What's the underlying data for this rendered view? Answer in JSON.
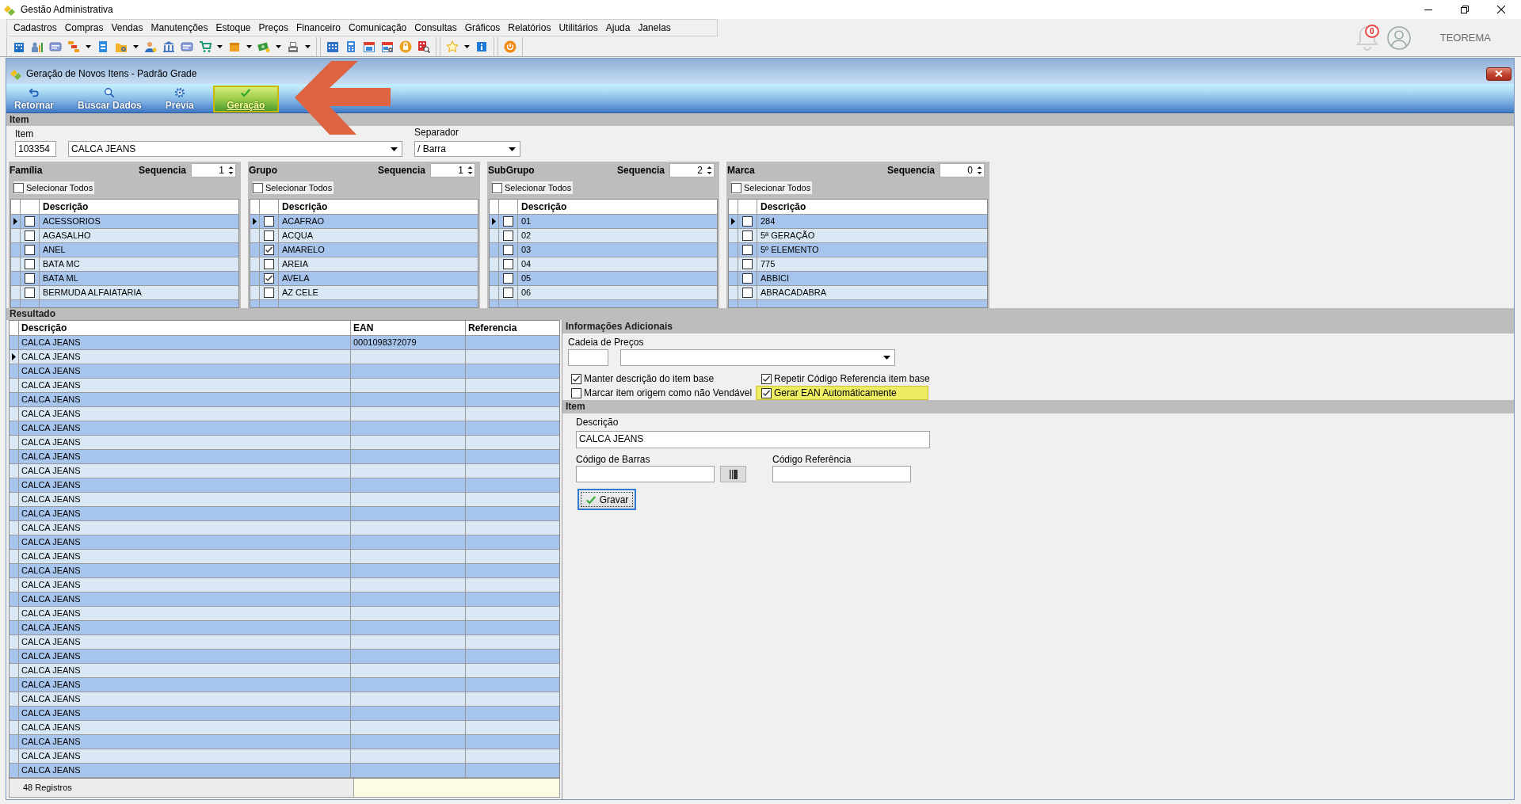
{
  "app_window": {
    "title": "Gestão Administrativa"
  },
  "menu_bar": [
    "Cadastros",
    "Compras",
    "Vendas",
    "Manutenções",
    "Estoque",
    "Preços",
    "Financeiro",
    "Comunicação",
    "Consultas",
    "Gráficos",
    "Relatórios",
    "Utilitários",
    "Ajuda",
    "Janelas"
  ],
  "header": {
    "notification_count": "0",
    "user_name": "TEOREMA"
  },
  "child_window": {
    "title": "Geração de Novos Itens - Padrão Grade"
  },
  "ribbon": [
    {
      "label": "Retornar",
      "kind": "return",
      "highlighted": false
    },
    {
      "label": "Buscar Dados",
      "kind": "search",
      "highlighted": false
    },
    {
      "label": "Prévia",
      "kind": "preview",
      "highlighted": false
    },
    {
      "label": "Geração",
      "kind": "generate",
      "highlighted": true
    }
  ],
  "item_section": {
    "title": "Item",
    "item_label": "Item",
    "item_code": "103354",
    "item_name": "CALCA JEANS",
    "separator_label": "Separador",
    "separator": "/ Barra"
  },
  "panels": [
    {
      "title": "Família",
      "sequence_label": "Sequencia",
      "sequence": "1",
      "select_all": {
        "label": "Selecionar Todos",
        "checked": false
      },
      "column": "Descrição",
      "rows": [
        {
          "text": "ACESSORIOS",
          "checked": false,
          "selected": true
        },
        {
          "text": "AGASALHO",
          "checked": false,
          "selected": false
        },
        {
          "text": "ANEL",
          "checked": false,
          "selected": false
        },
        {
          "text": "BATA MC",
          "checked": false,
          "selected": false
        },
        {
          "text": "BATA ML",
          "checked": false,
          "selected": false
        },
        {
          "text": "BERMUDA ALFAIATARIA",
          "checked": false,
          "selected": false
        }
      ]
    },
    {
      "title": "Grupo",
      "sequence_label": "Sequencia",
      "sequence": "1",
      "select_all": {
        "label": "Selecionar Todos",
        "checked": false
      },
      "column": "Descrição",
      "rows": [
        {
          "text": "ACAFRAO",
          "checked": false,
          "selected": true
        },
        {
          "text": "ACQUA",
          "checked": false,
          "selected": false
        },
        {
          "text": "AMARELO",
          "checked": true,
          "selected": false
        },
        {
          "text": "AREIA",
          "checked": false,
          "selected": false
        },
        {
          "text": "AVELA",
          "checked": true,
          "selected": false
        },
        {
          "text": "AZ CELE",
          "checked": false,
          "selected": false
        }
      ]
    },
    {
      "title": "SubGrupo",
      "sequence_label": "Sequencia",
      "sequence": "2",
      "select_all": {
        "label": "Selecionar Todos",
        "checked": false
      },
      "column": "Descrição",
      "rows": [
        {
          "text": "01",
          "checked": false,
          "selected": true
        },
        {
          "text": "02",
          "checked": false,
          "selected": false
        },
        {
          "text": "03",
          "checked": false,
          "selected": false
        },
        {
          "text": "04",
          "checked": false,
          "selected": false
        },
        {
          "text": "05",
          "checked": false,
          "selected": false
        },
        {
          "text": "06",
          "checked": false,
          "selected": false
        }
      ]
    },
    {
      "title": "Marca",
      "sequence_label": "Sequencia",
      "sequence": "0",
      "select_all": {
        "label": "Selecionar Todos",
        "checked": false
      },
      "column": "Descrição",
      "rows": [
        {
          "text": "284",
          "checked": false,
          "selected": true
        },
        {
          "text": "5ª GERAÇÃO",
          "checked": false,
          "selected": false
        },
        {
          "text": "5º ELEMENTO",
          "checked": false,
          "selected": false
        },
        {
          "text": "775",
          "checked": false,
          "selected": false
        },
        {
          "text": "ABBICI",
          "checked": false,
          "selected": false
        },
        {
          "text": "ABRACADABRA",
          "checked": false,
          "selected": false
        }
      ]
    }
  ],
  "result": {
    "title": "Resultado",
    "columns": [
      "Descrição",
      "EAN",
      "Referencia"
    ],
    "rows": [
      {
        "description": "CALCA JEANS",
        "ean": "0001098372079",
        "selected": false
      },
      {
        "description": "CALCA JEANS",
        "selected": true
      },
      {
        "description": "CALCA JEANS",
        "selected": false
      },
      {
        "description": "CALCA JEANS",
        "selected": false
      },
      {
        "description": "CALCA JEANS",
        "selected": false
      },
      {
        "description": "CALCA JEANS",
        "selected": false
      },
      {
        "description": "CALCA JEANS",
        "selected": false
      },
      {
        "description": "CALCA JEANS",
        "selected": false
      },
      {
        "description": "CALCA JEANS",
        "selected": false
      },
      {
        "description": "CALCA JEANS",
        "selected": false
      },
      {
        "description": "CALCA JEANS",
        "selected": false
      },
      {
        "description": "CALCA JEANS",
        "selected": false
      },
      {
        "description": "CALCA JEANS",
        "selected": false
      },
      {
        "description": "CALCA JEANS",
        "selected": false
      },
      {
        "description": "CALCA JEANS",
        "selected": false
      },
      {
        "description": "CALCA JEANS",
        "selected": false
      },
      {
        "description": "CALCA JEANS",
        "selected": false
      },
      {
        "description": "CALCA JEANS",
        "selected": false
      },
      {
        "description": "CALCA JEANS",
        "selected": false
      },
      {
        "description": "CALCA JEANS",
        "selected": false
      },
      {
        "description": "CALCA JEANS",
        "selected": false
      },
      {
        "description": "CALCA JEANS",
        "selected": false
      },
      {
        "description": "CALCA JEANS",
        "selected": false
      },
      {
        "description": "CALCA JEANS",
        "selected": false
      },
      {
        "description": "CALCA JEANS",
        "selected": false
      },
      {
        "description": "CALCA JEANS",
        "selected": false
      },
      {
        "description": "CALCA JEANS",
        "selected": false
      },
      {
        "description": "CALCA JEANS",
        "selected": false
      },
      {
        "description": "CALCA JEANS",
        "selected": false
      },
      {
        "description": "CALCA JEANS",
        "selected": false
      },
      {
        "description": "CALCA JEANS",
        "selected": false
      }
    ],
    "record_count": "48 Registros"
  },
  "additional_info": {
    "title": "Informações Adicionais",
    "price_chain_label": "Cadeia de Preços",
    "options": [
      {
        "label": "Manter descrição do item base",
        "checked": true,
        "highlighted": false
      },
      {
        "label": "Repetir Código Referencia item base",
        "checked": true,
        "highlighted": false
      },
      {
        "label": "Marcar item origem como não Vendável",
        "checked": false,
        "highlighted": false
      },
      {
        "label": "Gerar EAN Automáticamente",
        "checked": true,
        "highlighted": true
      }
    ]
  },
  "item_form": {
    "title": "Item",
    "description_label": "Descrição",
    "description": "CALCA JEANS",
    "barcode_label": "Código de Barras",
    "reference_label": "Código Referência",
    "save_button": "Gravar"
  }
}
